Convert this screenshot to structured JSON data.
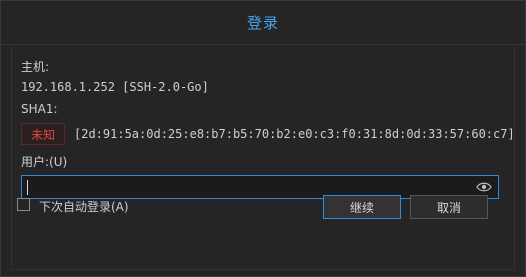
{
  "dialog": {
    "title": "登录"
  },
  "host": {
    "label": "主机:",
    "value": "192.168.1.252 [SSH-2.0-Go]"
  },
  "sha1": {
    "label": "SHA1:",
    "status_badge": "未知",
    "value": "[2d:91:5a:0d:25:e8:b7:b5:70:b2:e0:c3:f0:31:8d:0d:33:57:60:c7]"
  },
  "user": {
    "label": "用户:(U)",
    "input_value": ""
  },
  "auto_login": {
    "label": "下次自动登录(A)",
    "checked": false
  },
  "buttons": {
    "continue_label": "继续",
    "cancel_label": "取消"
  },
  "colors": {
    "accent": "#4aa3e8",
    "warning": "#e0473e"
  }
}
